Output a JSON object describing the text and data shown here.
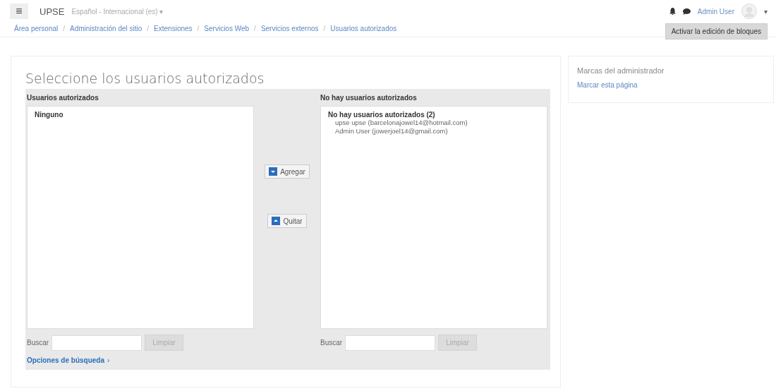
{
  "navbar": {
    "menu_icon": "≡",
    "site_name": "UPSE",
    "language": "Español - Internacional (es)",
    "language_caret": "▾",
    "user_name": "Admin User",
    "user_caret": "▾"
  },
  "breadcrumb": [
    "Área personal",
    "Administración del sitio",
    "Extensiones",
    "Servicios Web",
    "Servicios externos",
    "Usuarios autorizados"
  ],
  "breadcrumb_separator": "/",
  "edit_blocks_button": "Activar la edición de bloques",
  "main": {
    "title": "Seleccione los usuarios autorizados",
    "left": {
      "heading": "Usuarios autorizados",
      "groups": [
        {
          "label": "Ninguno"
        }
      ],
      "search_label": "Buscar",
      "clear_button": "Limpiar"
    },
    "add_button": "Agregar",
    "remove_button": "Quitar",
    "right": {
      "heading": "No hay usuarios autorizados",
      "groups": [
        {
          "label": "No hay usuarios autorizados (2)",
          "options": [
            "upse upse (barcelonajowel14@hotmail.com)",
            "Admin User (jowerjoel14@gmail.com)"
          ]
        }
      ],
      "search_label": "Buscar",
      "clear_button": "Limpiar"
    },
    "search_options_link": "Opciones de búsqueda",
    "search_options_caret": "›"
  },
  "admin_block": {
    "title": "Marcas del administrador",
    "link": "Marcar esta página"
  }
}
